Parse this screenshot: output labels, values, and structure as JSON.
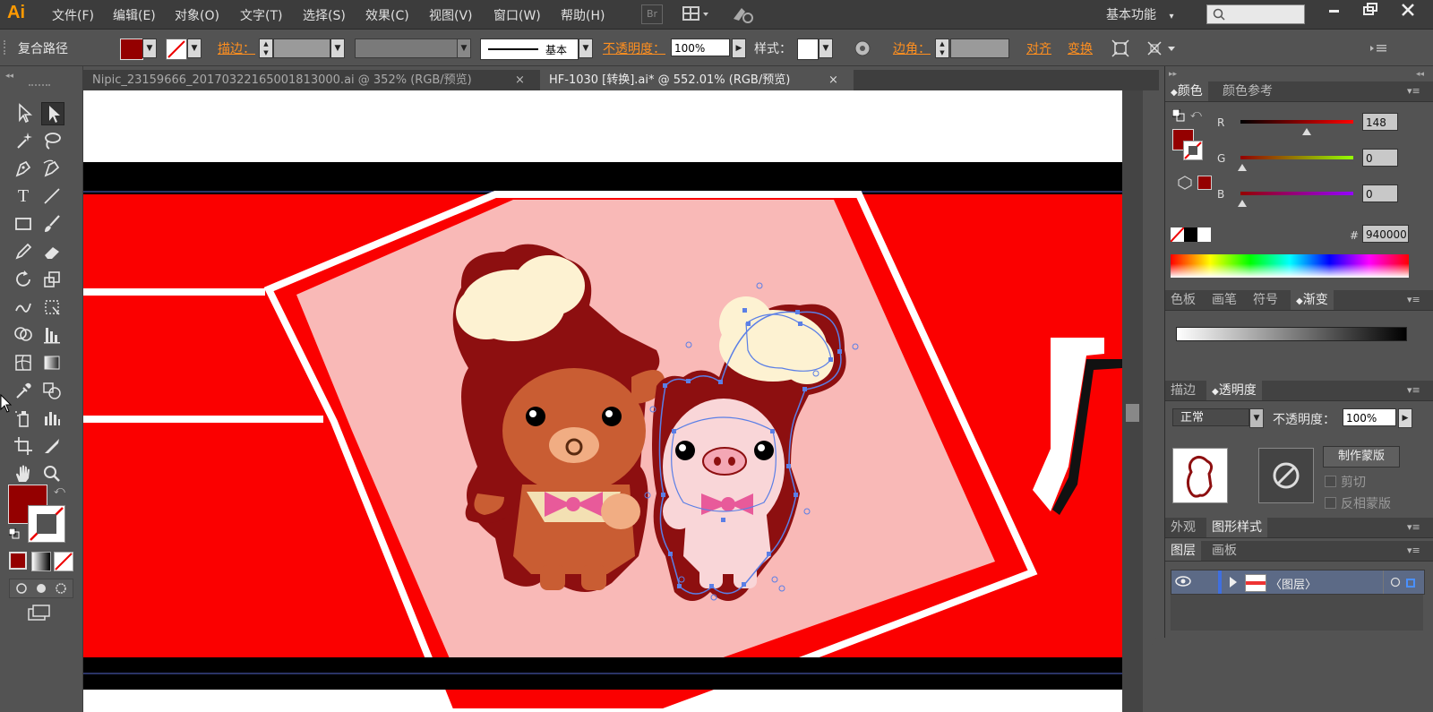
{
  "app": {
    "logo": "Ai"
  },
  "menu": [
    "文件(F)",
    "编辑(E)",
    "对象(O)",
    "文字(T)",
    "选择(S)",
    "效果(C)",
    "视图(V)",
    "窗口(W)",
    "帮助(H)"
  ],
  "menubar": {
    "bridge_label": "Br",
    "workspace": "基本功能",
    "workspace_arrow": "▾"
  },
  "control": {
    "selection_type": "复合路径",
    "stroke_label": "描边：",
    "stroke_profile": "基本",
    "opacity_label": "不透明度：",
    "opacity_value": "100%",
    "style_label": "样式：",
    "corner_label": "边角：",
    "align_label": "对齐",
    "transform_label": "变换",
    "fill_color": "#940000"
  },
  "documents": [
    {
      "name": "Nipic_23159666_20170322165001813000.ai @ 352% (RGB/预览)",
      "close": "×"
    },
    {
      "name": "HF-1030 [转换].ai* @ 552.01% (RGB/预览)",
      "close": "×"
    }
  ],
  "tools": {
    "icons": [
      "selection-tool-icon",
      "direct-selection-tool-icon",
      "magic-wand-tool-icon",
      "lasso-tool-icon",
      "pen-tool-icon",
      "curvature-tool-icon",
      "type-tool-icon",
      "line-tool-icon",
      "rectangle-tool-icon",
      "paintbrush-tool-icon",
      "pencil-tool-icon",
      "eraser-tool-icon",
      "rotate-tool-icon",
      "scale-tool-icon",
      "warp-tool-icon",
      "free-transform-tool-icon",
      "shape-builder-tool-icon",
      "graph-tool-icon",
      "mesh-tool-icon",
      "gradient-tool-icon",
      "eyedropper-tool-icon",
      "blend-tool-icon",
      "symbol-sprayer-tool-icon",
      "column-graph-tool-icon",
      "artboard-tool-icon",
      "slice-tool-icon",
      "hand-tool-icon",
      "zoom-tool-icon"
    ],
    "text_tool_glyph": "T"
  },
  "color_panel": {
    "tab_color": "颜色",
    "tab_color_guide": "颜色参考",
    "r_label": "R",
    "g_label": "G",
    "b_label": "B",
    "r": "148",
    "g": "0",
    "b": "0",
    "hash_label": "#",
    "hex": "940000"
  },
  "panel_tabs_swatch": [
    "色板",
    "画笔",
    "符号",
    "渐变"
  ],
  "panel_tabs_transparency": [
    "描边",
    "透明度"
  ],
  "transparency": {
    "blend_mode": "正常",
    "opacity_label": "不透明度：",
    "opacity_value": "100%",
    "make_mask": "制作蒙版",
    "clip": "剪切",
    "invert_mask": "反相蒙版"
  },
  "panel_tabs_appearance": [
    "外观",
    "图形样式"
  ],
  "panel_tabs_layers": [
    "图层",
    "画板"
  ],
  "layers": [
    {
      "name": "〈图层〉"
    }
  ],
  "colors": {
    "accent_orange": "#ff8f1f",
    "canvas_red": "#fb0000",
    "inner_pink": "#f9b9b7",
    "fill": "#940000"
  }
}
